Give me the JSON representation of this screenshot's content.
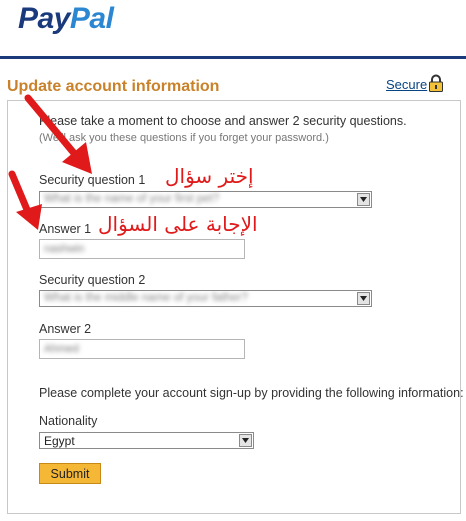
{
  "brand": {
    "pay": "Pay",
    "pal": "Pal"
  },
  "header": {
    "title": "Update account information",
    "secure_link": "Secure"
  },
  "form": {
    "intro": "Please take a moment to choose and answer 2 security questions.",
    "note": "(We'll ask you these questions if you forget your password.)",
    "q1": {
      "label": "Security question 1",
      "value": "What is the name of your first pet?"
    },
    "a1": {
      "label": "Answer 1",
      "value": "nashwin"
    },
    "q2": {
      "label": "Security question 2",
      "value": "What is the middle name of your father?"
    },
    "a2": {
      "label": "Answer 2",
      "value": "Ahmed"
    },
    "complete_text": "Please complete your account sign-up by providing the following information:",
    "nationality": {
      "label": "Nationality",
      "value": "Egypt"
    },
    "submit_label": "Submit"
  },
  "annotations": {
    "choose_question": "إختر سؤال",
    "answer_question": "الإجابة على السؤال"
  },
  "colors": {
    "brand_dark": "#1a3a7c",
    "brand_light": "#2b87d1",
    "title": "#c9822a",
    "annotation": "#e01a1a",
    "submit": "#f5b836"
  }
}
